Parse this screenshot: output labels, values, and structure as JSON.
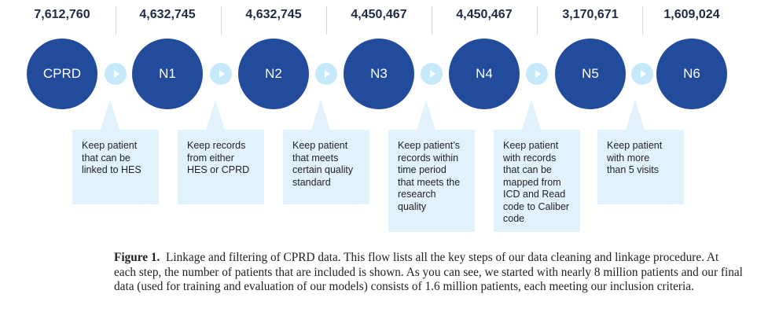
{
  "flow": {
    "nodes": [
      {
        "label": "CPRD",
        "count": "7,612,760"
      },
      {
        "label": "N1",
        "count": "4,632,745"
      },
      {
        "label": "N2",
        "count": "4,632,745"
      },
      {
        "label": "N3",
        "count": "4,450,467"
      },
      {
        "label": "N4",
        "count": "4,450,467"
      },
      {
        "label": "N5",
        "count": "3,170,671"
      },
      {
        "label": "N6",
        "count": "1,609,024"
      }
    ],
    "steps": [
      "Keep patient\nthat can be\nlinked to HES",
      "Keep records\nfrom either\nHES or CPRD",
      "Keep patient\nthat meets\ncertain quality\nstandard",
      "Keep patient’s\nrecords within\ntime period\nthat meets the\nresearch\nquality",
      "Keep patient\nwith records\nthat can be\nmapped from\nICD and Read\ncode to Caliber\ncode",
      "Keep patient\nwith more\nthan 5 visits"
    ]
  },
  "caption": {
    "label": "Figure 1.",
    "text": "Linkage and filtering of CPRD data. This flow lists all the key steps of our data cleaning and linkage procedure. At each step, the number of patients that are included is shown. As you can see, we started with nearly 8 million patients and our final data (used for training and evaluation of our models) consists of 1.6 million patients, each meeting our inclusion criteria."
  }
}
